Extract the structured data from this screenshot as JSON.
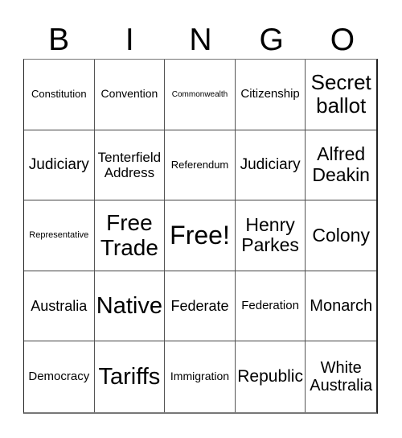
{
  "header": {
    "letters": [
      "B",
      "I",
      "N",
      "G",
      "O"
    ]
  },
  "card": {
    "rows": [
      [
        "Constitution",
        "Convention",
        "Commonwealth",
        "Citizenship",
        "Secret ballot"
      ],
      [
        "Judiciary",
        "Tenterfield Address",
        "Referendum",
        "Judiciary",
        "Alfred Deakin"
      ],
      [
        "Representative",
        "Free Trade",
        "Free!",
        "Henry Parkes",
        "Colony"
      ],
      [
        "Australia",
        "Native",
        "Federate",
        "Federation",
        "Monarch"
      ],
      [
        "Democracy",
        "Tariffs",
        "Immigration",
        "Republic",
        "White Australia"
      ]
    ]
  }
}
